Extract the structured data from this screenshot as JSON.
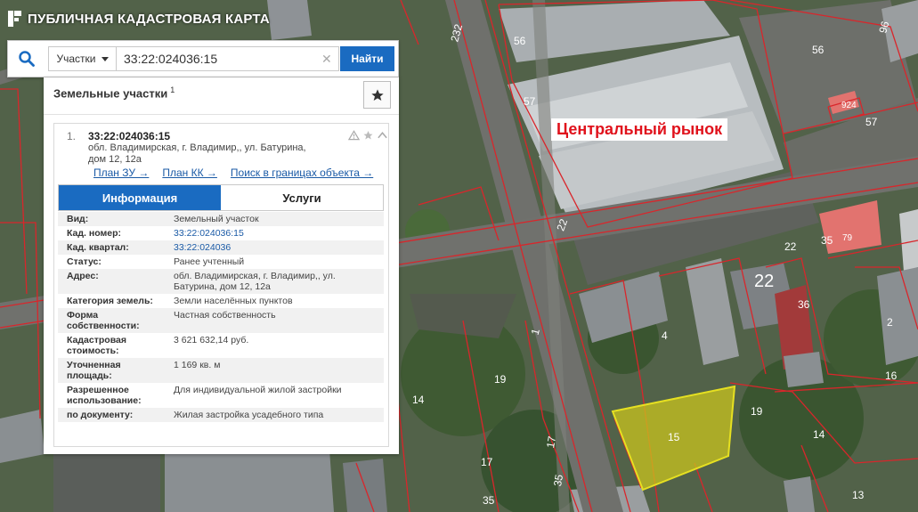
{
  "app": {
    "title": "ПУБЛИЧНАЯ КАДАСТРОВАЯ КАРТА"
  },
  "search": {
    "type_label": "Участки",
    "query": "33:22:024036:15",
    "button_label": "Найти"
  },
  "panel": {
    "title": "Земельные участки",
    "count": "1",
    "result": {
      "index": "1.",
      "cad_number": "33:22:024036:15",
      "address_line1": "обл. Владимирская, г. Владимир,, ул. Батурина,",
      "address_line2": "дом 12, 12а"
    },
    "links": [
      "План ЗУ →",
      "План КК →",
      "Поиск в границах объекта →"
    ],
    "tabs": {
      "info": "Информация",
      "services": "Услуги"
    },
    "rows": [
      {
        "key": "Вид:",
        "value": "Земельный участок"
      },
      {
        "key": "Кад. номер:",
        "value": "33:22:024036:15"
      },
      {
        "key": "Кад. квартал:",
        "value": "33:22:024036"
      },
      {
        "key": "Статус:",
        "value": "Ранее учтенный"
      },
      {
        "key": "Адрес:",
        "value": "обл. Владимирская, г. Владимир,, ул. Батурина, дом 12, 12а"
      },
      {
        "key": "Категория земель:",
        "value": "Земли населённых пунктов"
      },
      {
        "key": "Форма собственности:",
        "value": "Частная собственность"
      },
      {
        "key": "Кадастровая стоимость:",
        "value": "3 621 632,14 руб."
      },
      {
        "key": "Уточненная площадь:",
        "value": "1 169 кв. м"
      },
      {
        "key": "Разрешенное использование:",
        "value": "Для индивидуальной жилой застройки"
      },
      {
        "key": "по документу:",
        "value": "Жилая застройка усадебного типа"
      }
    ]
  },
  "map": {
    "market_label": "Центральный рынок",
    "labels": [
      "232",
      "56",
      "56",
      "57",
      "57",
      "924",
      "22",
      "22",
      "22",
      "35",
      "79",
      "36",
      "2",
      "4",
      "16",
      "19",
      "19",
      "14",
      "14",
      "17",
      "17",
      "35",
      "35",
      "13",
      "15",
      "1"
    ],
    "colors": {
      "parcel_line": "#d9262b",
      "selected_fill": "#c9c41e",
      "accent": "#1a6bc1"
    }
  }
}
